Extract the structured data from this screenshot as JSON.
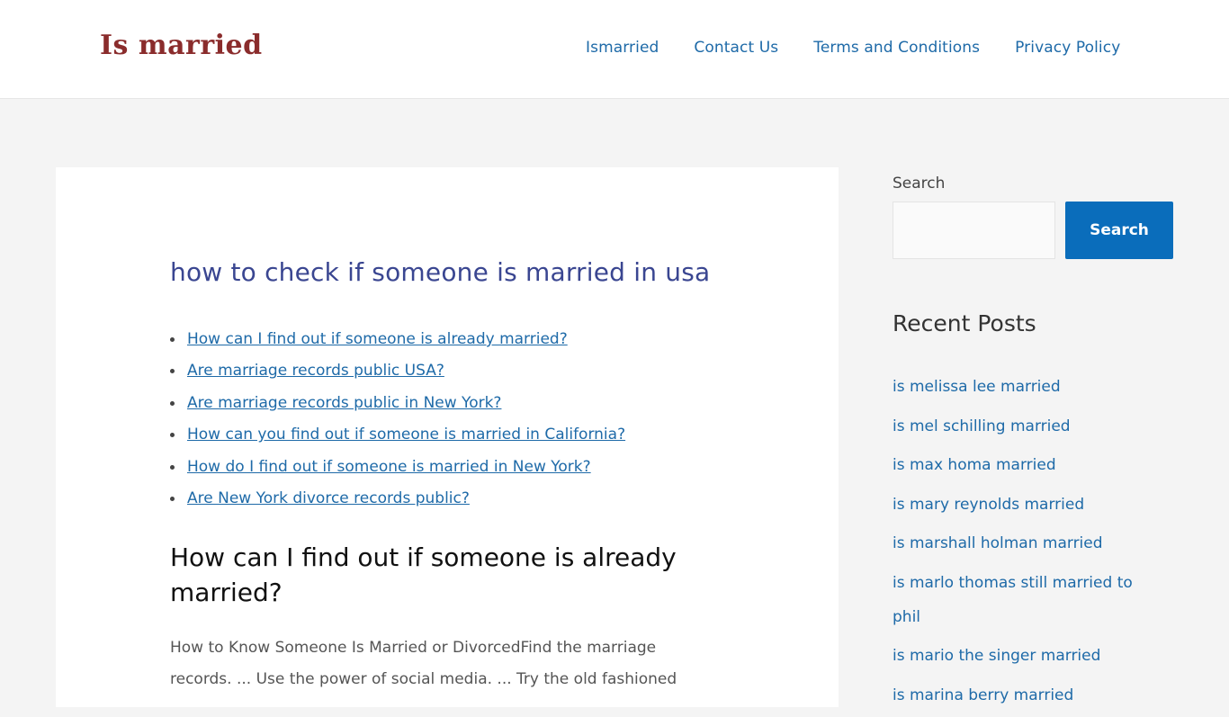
{
  "site": {
    "logo_text": "Is married",
    "brand_color": "#8a2c2c",
    "link_color": "#1e6aa8"
  },
  "nav": {
    "items": [
      {
        "label": "Ismarried"
      },
      {
        "label": "Contact Us"
      },
      {
        "label": "Terms and Conditions"
      },
      {
        "label": "Privacy Policy"
      }
    ]
  },
  "article": {
    "title": "how to check if someone is married in usa",
    "toc": [
      {
        "label": "How can I find out if someone is already married?"
      },
      {
        "label": "Are marriage records public USA?"
      },
      {
        "label": "Are marriage records public in New York?"
      },
      {
        "label": "How can you find out if someone is married in California?"
      },
      {
        "label": "How do I find out if someone is married in New York?"
      },
      {
        "label": "Are New York divorce records public?"
      }
    ],
    "section_heading": "How can I find out if someone is already married?",
    "section_text": "How to Know Someone Is Married or DivorcedFind the marriage records. ... Use the power of social media. ... Try the old fashioned"
  },
  "sidebar": {
    "search": {
      "label": "Search",
      "input_value": "",
      "input_placeholder": "",
      "button_label": "Search",
      "button_color": "#0a6dbb"
    },
    "recent_posts": {
      "title": "Recent Posts",
      "items": [
        {
          "label": "is melissa lee married"
        },
        {
          "label": "is mel schilling married"
        },
        {
          "label": "is max homa married"
        },
        {
          "label": "is mary reynolds married"
        },
        {
          "label": "is marshall holman married"
        },
        {
          "label": "is marlo thomas still married to phil"
        },
        {
          "label": "is mario the singer married"
        },
        {
          "label": "is marina berry married"
        }
      ]
    }
  }
}
